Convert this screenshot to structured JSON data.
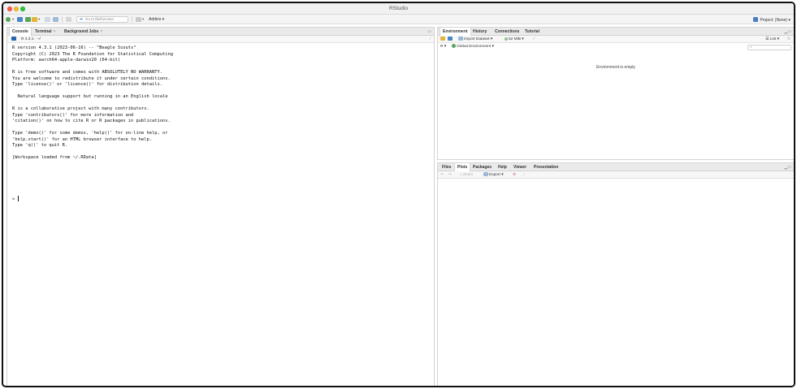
{
  "window": {
    "title": "RStudio"
  },
  "toolbar": {
    "goto_placeholder": "Go to file/function",
    "addins_label": "Addins",
    "project_label": "Project: (None)"
  },
  "console_pane": {
    "tabs": [
      {
        "label": "Console",
        "active": true
      },
      {
        "label": "Terminal",
        "close": "×"
      },
      {
        "label": "Background Jobs",
        "close": "×"
      }
    ],
    "version_path": "R 4.3.1 · ~/",
    "lines": [
      "R version 4.3.1 (2023-06-16) -- \"Beagle Scouts\"",
      "Copyright (C) 2023 The R Foundation for Statistical Computing",
      "Platform: aarch64-apple-darwin20 (64-bit)",
      "",
      "R is free software and comes with ABSOLUTELY NO WARRANTY.",
      "You are welcome to redistribute it under certain conditions.",
      "Type 'license()' or 'licence()' for distribution details.",
      "",
      "  Natural language support but running in an English locale",
      "",
      "R is a collaborative project with many contributors.",
      "Type 'contributors()' for more information and",
      "'citation()' on how to cite R or R packages in publications.",
      "",
      "Type 'demo()' for some demos, 'help()' for on-line help, or",
      "'help.start()' for an HTML browser interface to help.",
      "Type 'q()' to quit R.",
      "",
      "[Workspace loaded from ~/.RData]"
    ],
    "prompt": ">"
  },
  "env_pane": {
    "tabs": [
      {
        "label": "Environment",
        "active": true
      },
      {
        "label": "History"
      },
      {
        "label": "Connections"
      },
      {
        "label": "Tutorial"
      }
    ],
    "import_label": "Import Dataset",
    "memory_label": "52 MiB",
    "list_label": "List",
    "language_label": "R",
    "scope_label": "Global Environment",
    "empty_message": "Environment is empty"
  },
  "files_pane": {
    "tabs": [
      {
        "label": "Files"
      },
      {
        "label": "Plots",
        "active": true
      },
      {
        "label": "Packages"
      },
      {
        "label": "Help"
      },
      {
        "label": "Viewer"
      },
      {
        "label": "Presentation"
      }
    ],
    "zoom_label": "Zoom",
    "export_label": "Export"
  },
  "colors": {
    "tab_bar": "#eaeaea",
    "accent_blue": "#4a86c8",
    "icon_green": "#5aa55a",
    "icon_yellow": "#e5b53a",
    "traffic_red": "#ff5f57",
    "traffic_yellow": "#febc2e",
    "traffic_green": "#28c840"
  },
  "icons": {
    "new_file": "plus-circle-icon",
    "open_project": "cube-icon",
    "open_file": "folder-icon",
    "save": "floppy-icon",
    "broom": "broom-icon",
    "r_logo": "r-logo-icon",
    "search": "magnifier-icon"
  }
}
